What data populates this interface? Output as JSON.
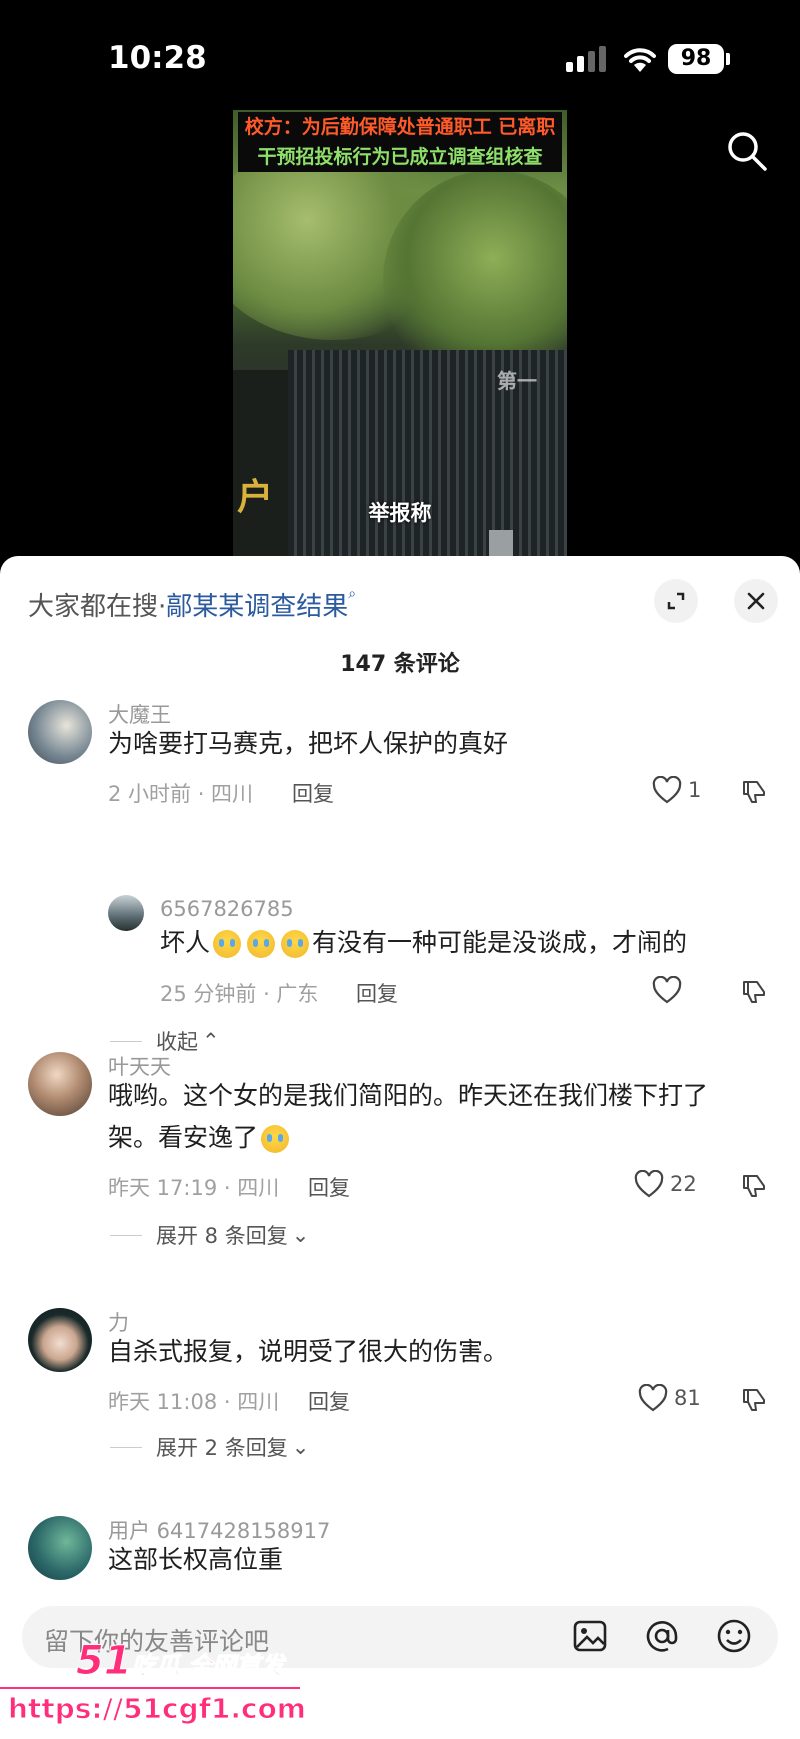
{
  "status_bar": {
    "time": "10:28",
    "battery": "98"
  },
  "video": {
    "caption_line1": "校方：为后勤保障处普通职工 已离职",
    "caption_line2": "干预招投标行为已成立调查组核查",
    "subtitle": "举报称",
    "sign_text": "户",
    "logo": "第一"
  },
  "comments_panel": {
    "hot_search_label": "大家都在搜·",
    "hot_search_term": "鄗某某调查结果",
    "count_text": "147 条评论",
    "reply_label": "回复"
  },
  "comments": [
    {
      "user": "大魔王",
      "text": "为啥要打马赛克，把坏人保护的真好",
      "meta": "2 小时前 · 四川",
      "likes": "1",
      "replies": [
        {
          "user": "6567826785",
          "text_before": "坏人",
          "text_after": "有没有一种可能是没谈成，才闹的",
          "meta": "25 分钟前 · 广东",
          "likes": ""
        }
      ],
      "collapse_label": "收起"
    },
    {
      "user": "叶天天",
      "text_line1": "哦哟。这个女的是我们简阳的。昨天还在我们楼下打了",
      "text_line2": "架。看安逸了",
      "meta": "昨天 17:19 · 四川",
      "likes": "22",
      "expand_label": "展开 8 条回复"
    },
    {
      "user": "力",
      "text": "自杀式报复，说明受了很大的伤害。",
      "meta": "昨天 11:08 · 四川",
      "likes": "81",
      "expand_label": "展开 2 条回复"
    },
    {
      "user": "用户 6417428158917",
      "text": "这部长权高位重"
    }
  ],
  "input_bar": {
    "placeholder": "留下你的友善评论吧"
  },
  "watermark": {
    "brand_num": "51",
    "brand_text": "吃瓜 全网首发",
    "url": "https://51cgf1.com"
  },
  "icons": [
    "search-icon",
    "expand-icon",
    "close-icon",
    "heart-icon",
    "dislike-icon",
    "image-icon",
    "at-icon",
    "emoji-icon",
    "wifi-icon",
    "signal-icon"
  ]
}
